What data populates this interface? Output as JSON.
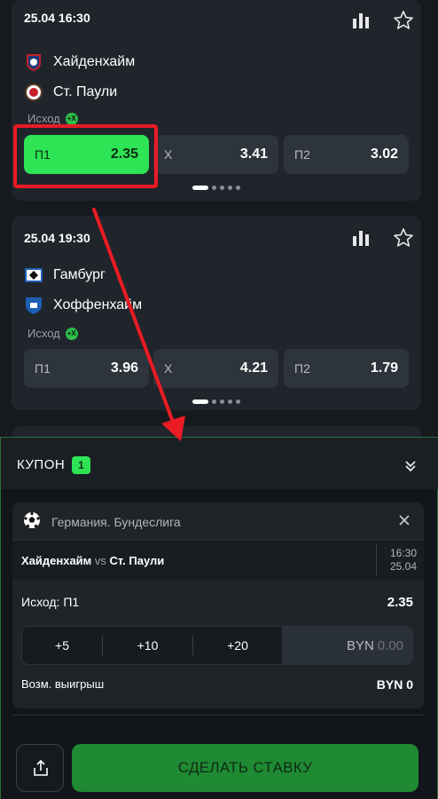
{
  "events": [
    {
      "datetime": "25.04 16:30",
      "home": "Хайденхайм",
      "away": "Ст. Паули",
      "market": "Исход",
      "market_badge": "+X",
      "odds": [
        {
          "label": "П1",
          "value": "2.35"
        },
        {
          "label": "Х",
          "value": "3.41"
        },
        {
          "label": "П2",
          "value": "3.02"
        }
      ]
    },
    {
      "datetime": "25.04 19:30",
      "home": "Гамбург",
      "away": "Хоффенхайм",
      "market": "Исход",
      "market_badge": "+X",
      "odds": [
        {
          "label": "П1",
          "value": "3.96"
        },
        {
          "label": "Х",
          "value": "4.21"
        },
        {
          "label": "П2",
          "value": "1.79"
        }
      ]
    }
  ],
  "coupon": {
    "title": "КУПОН",
    "count": "1",
    "league": "Германия. Бундеслига",
    "match_home": "Хайденхайм",
    "match_vs": "vs",
    "match_away": "Ст. Паули",
    "time": "16:30",
    "date": "25.04",
    "outcome": "Исход: П1",
    "outcome_odd": "2.35",
    "quick_stakes": [
      "+5",
      "+10",
      "+20"
    ],
    "currency": "BYN",
    "stake_placeholder": "0.00",
    "win_label": "Возм. выигрыш",
    "win_value": "BYN 0",
    "place_bet": "СДЕЛАТЬ СТАВКУ"
  },
  "colors": {
    "accent": "#2ee455",
    "highlight": "#ea1b23",
    "background": "#161a1f",
    "card": "#20252b"
  }
}
